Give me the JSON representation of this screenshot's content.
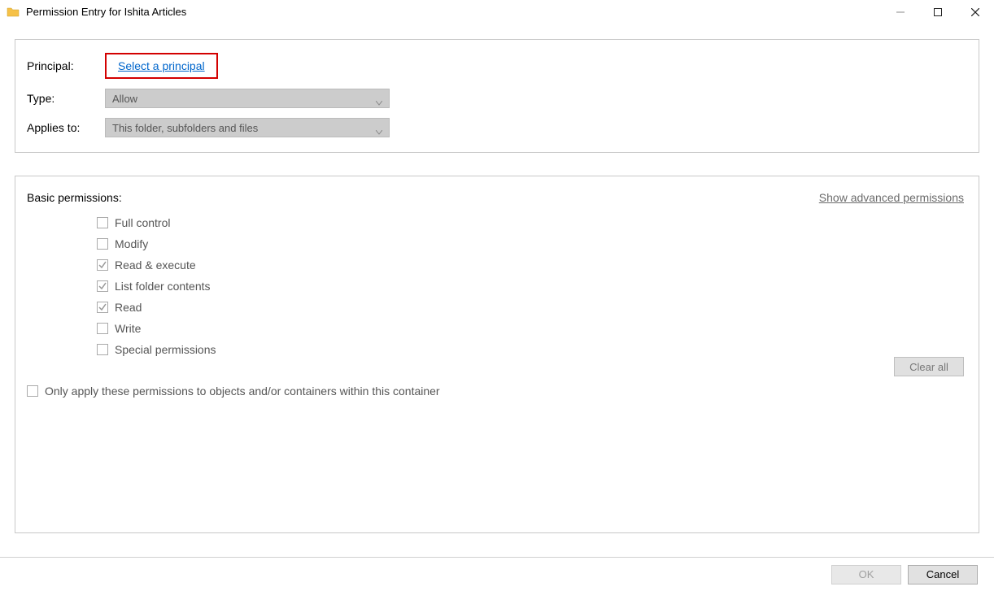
{
  "window": {
    "title": "Permission Entry for Ishita Articles"
  },
  "form": {
    "principal_label": "Principal:",
    "principal_link": "Select a principal",
    "type_label": "Type:",
    "type_value": "Allow",
    "applies_label": "Applies to:",
    "applies_value": "This folder, subfolders and files"
  },
  "permissions": {
    "heading": "Basic permissions:",
    "advanced_link": "Show advanced permissions",
    "items": [
      {
        "label": "Full control",
        "checked": false
      },
      {
        "label": "Modify",
        "checked": false
      },
      {
        "label": "Read & execute",
        "checked": true
      },
      {
        "label": "List folder contents",
        "checked": true
      },
      {
        "label": "Read",
        "checked": true
      },
      {
        "label": "Write",
        "checked": false
      },
      {
        "label": "Special permissions",
        "checked": false
      }
    ],
    "only_apply_label": "Only apply these permissions to objects and/or containers within this container",
    "only_apply_checked": false,
    "clear_all_label": "Clear all"
  },
  "footer": {
    "ok_label": "OK",
    "cancel_label": "Cancel"
  }
}
